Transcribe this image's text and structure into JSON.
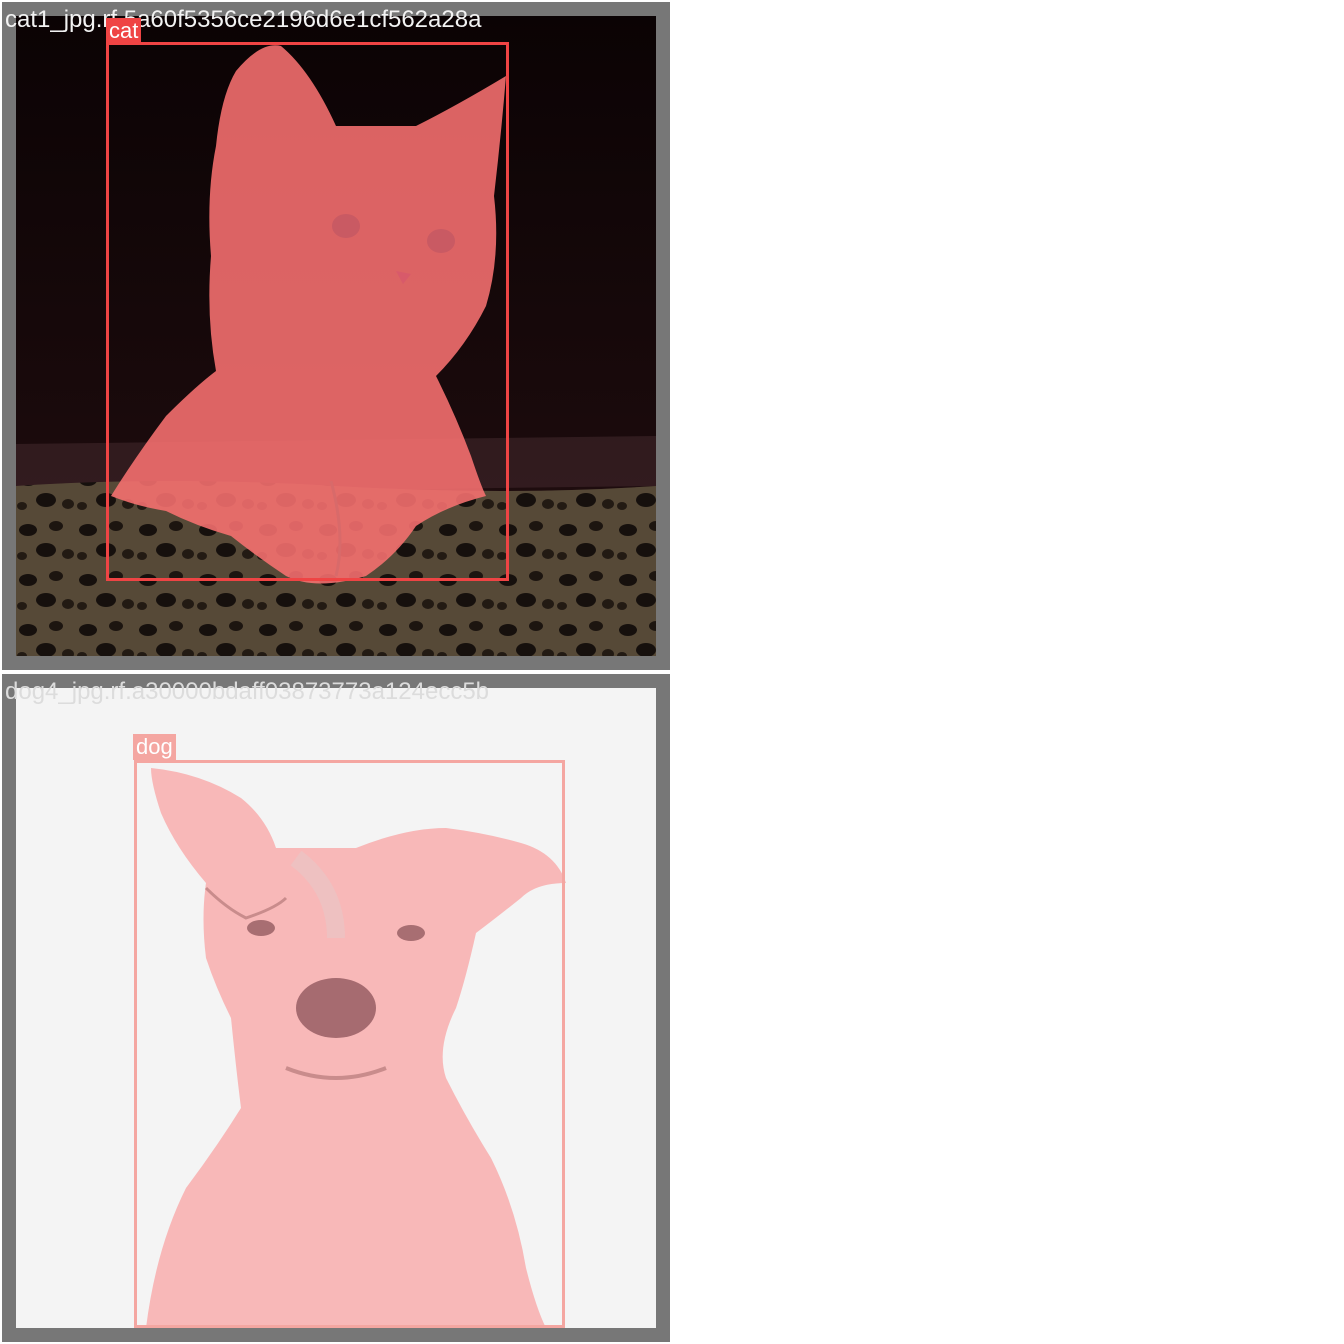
{
  "tiles": [
    {
      "filename": "cat1_jpg.rf.5a60f5356ce2196d6e1cf562a28a",
      "class_label": "cat",
      "box_color": "#ef4444",
      "mask_color": "#f87171"
    },
    {
      "filename": "dog4_jpg.rf.a30000bdaff03873773a124ecc5b",
      "class_label": "dog",
      "box_color": "#f4a6a1",
      "mask_color": "#f8b4b4"
    }
  ],
  "colors": {
    "tile_frame": "#777777",
    "page_background": "#ffffff"
  }
}
